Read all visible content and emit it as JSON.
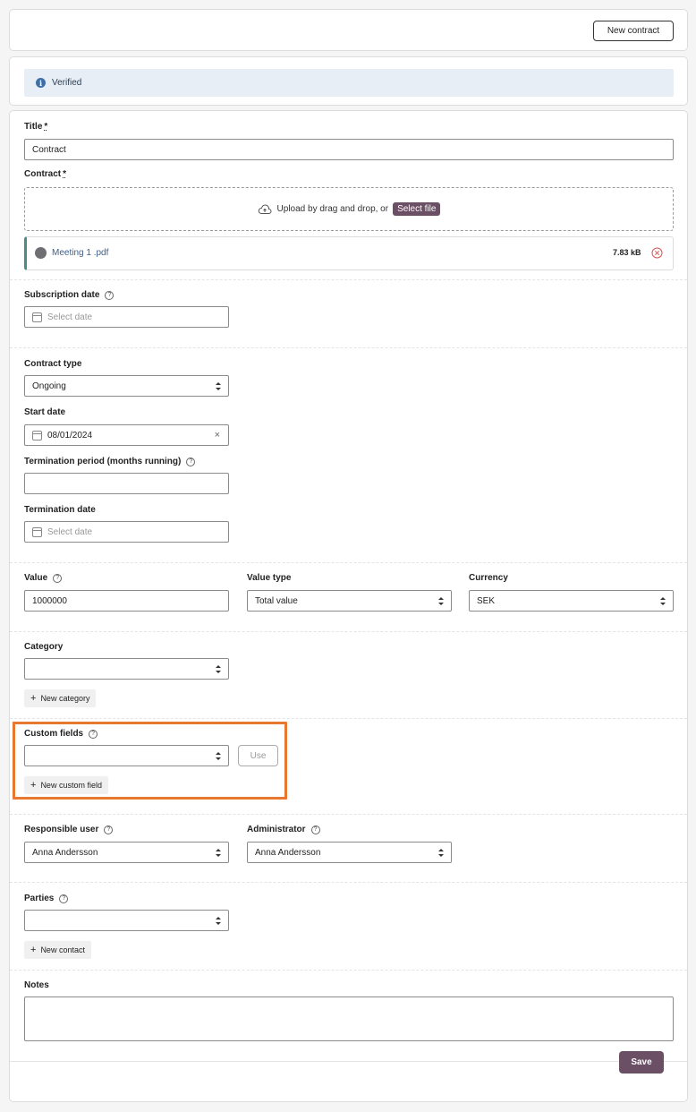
{
  "header": {
    "new_contract_label": "New contract"
  },
  "status": {
    "text": "Verified",
    "icon": "info-icon"
  },
  "form": {
    "title": {
      "label": "Title",
      "required": "*",
      "value": "Contract"
    },
    "contract": {
      "label": "Contract",
      "required": "*",
      "upload_text": "Upload by drag and drop, or",
      "select_file_label": "Select file",
      "file": {
        "name": "Meeting 1 .pdf",
        "size": "7.83 kB"
      }
    },
    "subscription_date": {
      "label": "Subscription date",
      "placeholder": "Select date"
    },
    "contract_type": {
      "label": "Contract type",
      "value": "Ongoing"
    },
    "start_date": {
      "label": "Start date",
      "value": "08/01/2024",
      "clear": "×"
    },
    "termination_period": {
      "label": "Termination period (months running)",
      "value": ""
    },
    "termination_date": {
      "label": "Termination date",
      "placeholder": "Select date"
    },
    "value": {
      "label": "Value",
      "value": "1000000"
    },
    "value_type": {
      "label": "Value type",
      "value": "Total value"
    },
    "currency": {
      "label": "Currency",
      "value": "SEK"
    },
    "category": {
      "label": "Category",
      "value": "",
      "new_label": "New category"
    },
    "custom_fields": {
      "label": "Custom fields",
      "value": "",
      "use_label": "Use",
      "new_label": "New custom field"
    },
    "responsible_user": {
      "label": "Responsible user",
      "value": "Anna Andersson"
    },
    "administrator": {
      "label": "Administrator",
      "value": "Anna Andersson"
    },
    "parties": {
      "label": "Parties",
      "value": "",
      "new_label": "New contact"
    },
    "notes": {
      "label": "Notes",
      "value": ""
    },
    "help_glyph": "?",
    "plus_glyph": "+",
    "save_label": "Save"
  },
  "colors": {
    "primary": "#6b4f65",
    "highlight": "#e8782f",
    "info": "#3f6fa6",
    "delete": "#d9534f"
  }
}
